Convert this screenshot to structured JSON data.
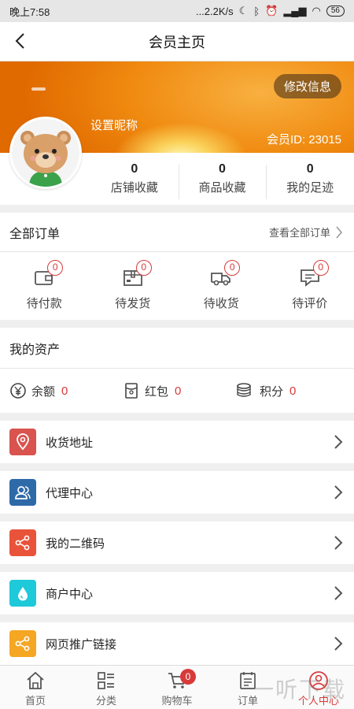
{
  "statusbar": {
    "time": "晚上7:58",
    "network": "...2.2K/s",
    "battery": "56"
  },
  "navbar": {
    "title": "会员主页"
  },
  "profile": {
    "edit_label": "修改信息",
    "nickname": "设置昵称",
    "member_id": "会员ID: 23015"
  },
  "stats": [
    {
      "value": "0",
      "label": "店铺收藏"
    },
    {
      "value": "0",
      "label": "商品收藏"
    },
    {
      "value": "0",
      "label": "我的足迹"
    }
  ],
  "orders": {
    "title": "全部订单",
    "view_all": "查看全部订单",
    "items": [
      {
        "label": "待付款",
        "count": "0",
        "icon": "wallet-icon"
      },
      {
        "label": "待发货",
        "count": "0",
        "icon": "package-icon"
      },
      {
        "label": "待收货",
        "count": "0",
        "icon": "truck-icon"
      },
      {
        "label": "待评价",
        "count": "0",
        "icon": "comment-icon"
      }
    ]
  },
  "assets": {
    "title": "我的资产",
    "items": [
      {
        "label": "余额",
        "value": "0",
        "icon": "yen-icon"
      },
      {
        "label": "红包",
        "value": "0",
        "icon": "red-packet-icon"
      },
      {
        "label": "积分",
        "value": "0",
        "icon": "coins-icon"
      }
    ]
  },
  "menu": [
    {
      "label": "收货地址",
      "icon": "location-pin-icon",
      "color": "#d9534f"
    },
    {
      "label": "代理中心",
      "icon": "agent-people-icon",
      "color": "#2f6aa8"
    },
    {
      "label": "我的二维码",
      "icon": "share-icon",
      "color": "#e8533a"
    },
    {
      "label": "商户中心",
      "icon": "water-drop-icon",
      "color": "#1ec9d9"
    },
    {
      "label": "网页推广链接",
      "icon": "share-icon",
      "color": "#f5a623"
    }
  ],
  "tabbar": {
    "items": [
      {
        "label": "首页",
        "icon": "home-icon"
      },
      {
        "label": "分类",
        "icon": "category-icon"
      },
      {
        "label": "购物车",
        "icon": "cart-icon",
        "badge": "0"
      },
      {
        "label": "订单",
        "icon": "order-list-icon"
      },
      {
        "label": "个人中心",
        "icon": "user-icon",
        "active": true
      }
    ]
  },
  "watermark": "一听下载",
  "colors": {
    "accent": "#d83a3a",
    "banner": "#f08a10"
  }
}
